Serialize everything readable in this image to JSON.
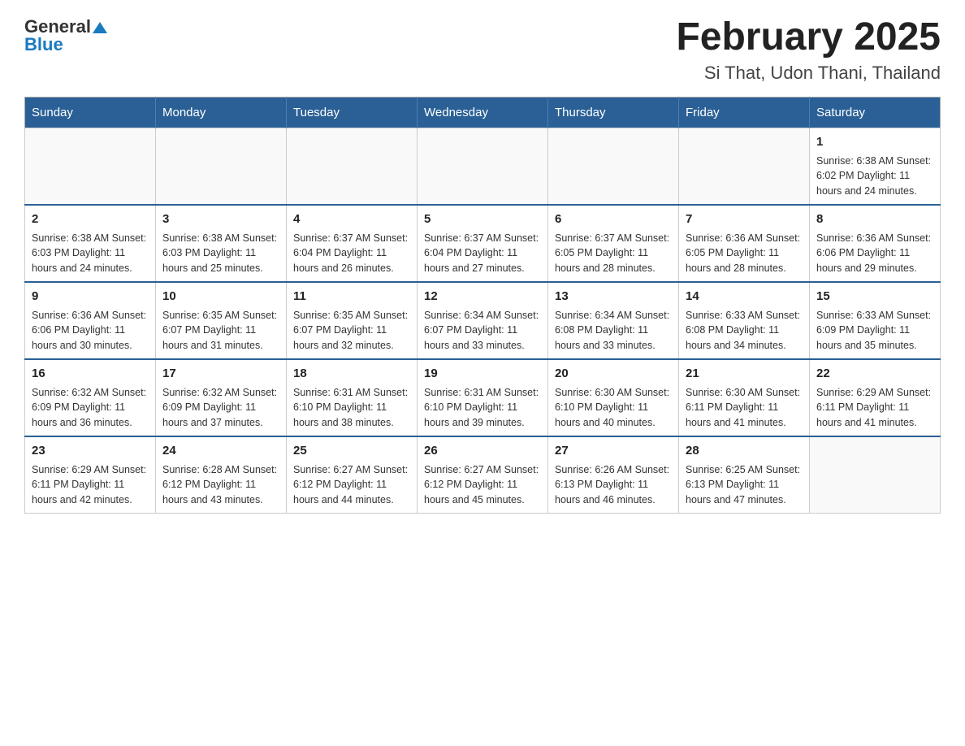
{
  "logo": {
    "general": "General",
    "arrow": "▲",
    "blue": "Blue"
  },
  "title": "February 2025",
  "subtitle": "Si That, Udon Thani, Thailand",
  "days_of_week": [
    "Sunday",
    "Monday",
    "Tuesday",
    "Wednesday",
    "Thursday",
    "Friday",
    "Saturday"
  ],
  "weeks": [
    {
      "days": [
        {
          "number": "",
          "info": ""
        },
        {
          "number": "",
          "info": ""
        },
        {
          "number": "",
          "info": ""
        },
        {
          "number": "",
          "info": ""
        },
        {
          "number": "",
          "info": ""
        },
        {
          "number": "",
          "info": ""
        },
        {
          "number": "1",
          "info": "Sunrise: 6:38 AM\nSunset: 6:02 PM\nDaylight: 11 hours\nand 24 minutes."
        }
      ]
    },
    {
      "days": [
        {
          "number": "2",
          "info": "Sunrise: 6:38 AM\nSunset: 6:03 PM\nDaylight: 11 hours\nand 24 minutes."
        },
        {
          "number": "3",
          "info": "Sunrise: 6:38 AM\nSunset: 6:03 PM\nDaylight: 11 hours\nand 25 minutes."
        },
        {
          "number": "4",
          "info": "Sunrise: 6:37 AM\nSunset: 6:04 PM\nDaylight: 11 hours\nand 26 minutes."
        },
        {
          "number": "5",
          "info": "Sunrise: 6:37 AM\nSunset: 6:04 PM\nDaylight: 11 hours\nand 27 minutes."
        },
        {
          "number": "6",
          "info": "Sunrise: 6:37 AM\nSunset: 6:05 PM\nDaylight: 11 hours\nand 28 minutes."
        },
        {
          "number": "7",
          "info": "Sunrise: 6:36 AM\nSunset: 6:05 PM\nDaylight: 11 hours\nand 28 minutes."
        },
        {
          "number": "8",
          "info": "Sunrise: 6:36 AM\nSunset: 6:06 PM\nDaylight: 11 hours\nand 29 minutes."
        }
      ]
    },
    {
      "days": [
        {
          "number": "9",
          "info": "Sunrise: 6:36 AM\nSunset: 6:06 PM\nDaylight: 11 hours\nand 30 minutes."
        },
        {
          "number": "10",
          "info": "Sunrise: 6:35 AM\nSunset: 6:07 PM\nDaylight: 11 hours\nand 31 minutes."
        },
        {
          "number": "11",
          "info": "Sunrise: 6:35 AM\nSunset: 6:07 PM\nDaylight: 11 hours\nand 32 minutes."
        },
        {
          "number": "12",
          "info": "Sunrise: 6:34 AM\nSunset: 6:07 PM\nDaylight: 11 hours\nand 33 minutes."
        },
        {
          "number": "13",
          "info": "Sunrise: 6:34 AM\nSunset: 6:08 PM\nDaylight: 11 hours\nand 33 minutes."
        },
        {
          "number": "14",
          "info": "Sunrise: 6:33 AM\nSunset: 6:08 PM\nDaylight: 11 hours\nand 34 minutes."
        },
        {
          "number": "15",
          "info": "Sunrise: 6:33 AM\nSunset: 6:09 PM\nDaylight: 11 hours\nand 35 minutes."
        }
      ]
    },
    {
      "days": [
        {
          "number": "16",
          "info": "Sunrise: 6:32 AM\nSunset: 6:09 PM\nDaylight: 11 hours\nand 36 minutes."
        },
        {
          "number": "17",
          "info": "Sunrise: 6:32 AM\nSunset: 6:09 PM\nDaylight: 11 hours\nand 37 minutes."
        },
        {
          "number": "18",
          "info": "Sunrise: 6:31 AM\nSunset: 6:10 PM\nDaylight: 11 hours\nand 38 minutes."
        },
        {
          "number": "19",
          "info": "Sunrise: 6:31 AM\nSunset: 6:10 PM\nDaylight: 11 hours\nand 39 minutes."
        },
        {
          "number": "20",
          "info": "Sunrise: 6:30 AM\nSunset: 6:10 PM\nDaylight: 11 hours\nand 40 minutes."
        },
        {
          "number": "21",
          "info": "Sunrise: 6:30 AM\nSunset: 6:11 PM\nDaylight: 11 hours\nand 41 minutes."
        },
        {
          "number": "22",
          "info": "Sunrise: 6:29 AM\nSunset: 6:11 PM\nDaylight: 11 hours\nand 41 minutes."
        }
      ]
    },
    {
      "days": [
        {
          "number": "23",
          "info": "Sunrise: 6:29 AM\nSunset: 6:11 PM\nDaylight: 11 hours\nand 42 minutes."
        },
        {
          "number": "24",
          "info": "Sunrise: 6:28 AM\nSunset: 6:12 PM\nDaylight: 11 hours\nand 43 minutes."
        },
        {
          "number": "25",
          "info": "Sunrise: 6:27 AM\nSunset: 6:12 PM\nDaylight: 11 hours\nand 44 minutes."
        },
        {
          "number": "26",
          "info": "Sunrise: 6:27 AM\nSunset: 6:12 PM\nDaylight: 11 hours\nand 45 minutes."
        },
        {
          "number": "27",
          "info": "Sunrise: 6:26 AM\nSunset: 6:13 PM\nDaylight: 11 hours\nand 46 minutes."
        },
        {
          "number": "28",
          "info": "Sunrise: 6:25 AM\nSunset: 6:13 PM\nDaylight: 11 hours\nand 47 minutes."
        },
        {
          "number": "",
          "info": ""
        }
      ]
    }
  ]
}
